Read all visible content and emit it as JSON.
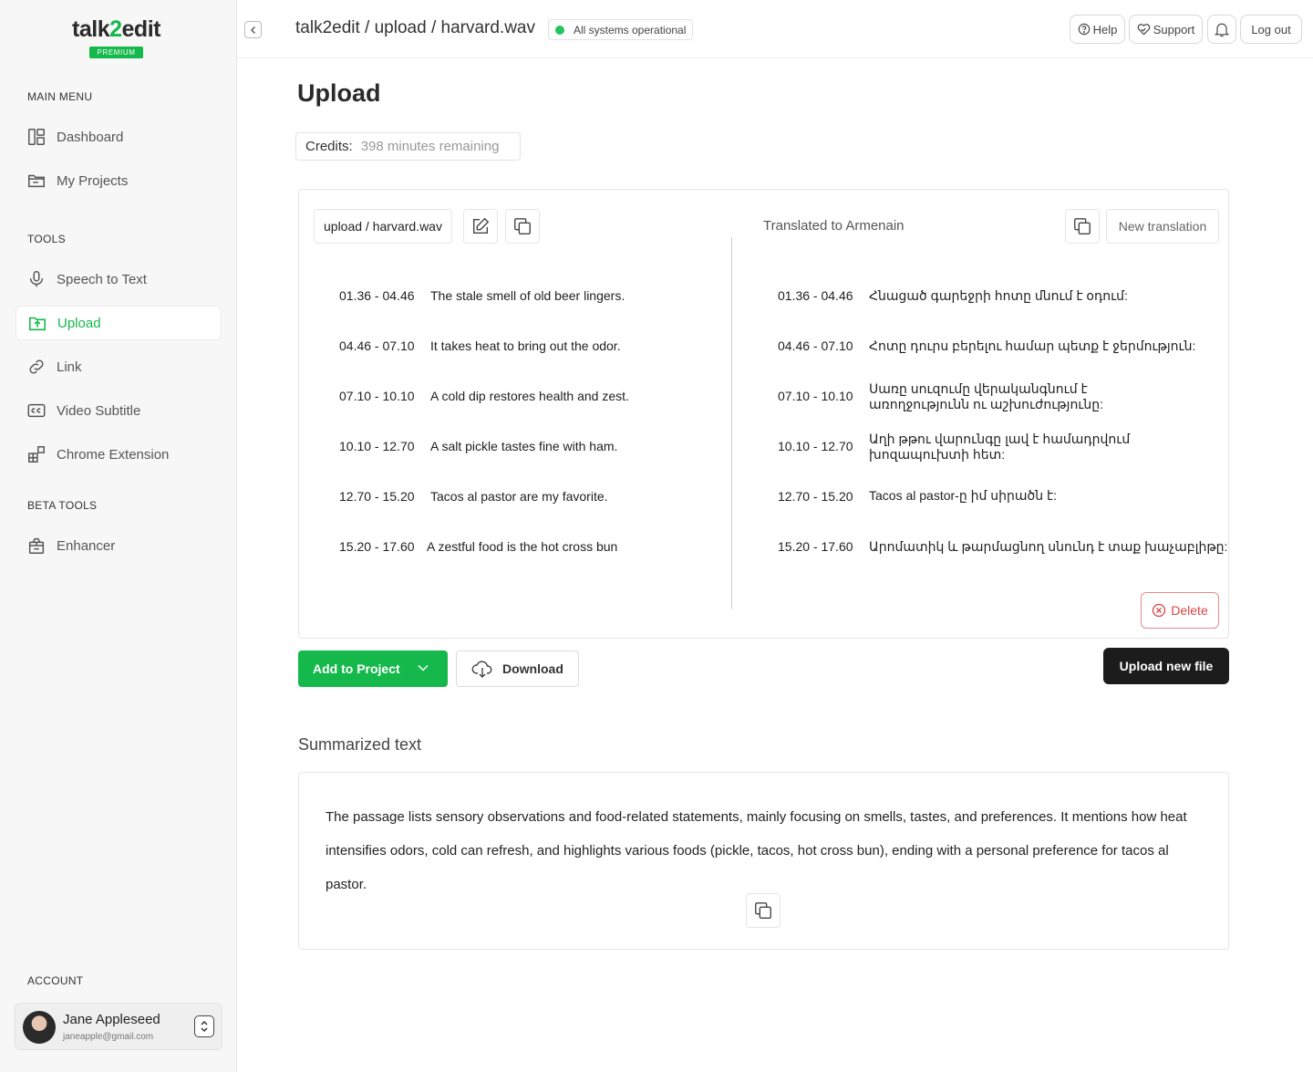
{
  "sidebar": {
    "logo": {
      "part1": "talk",
      "part2": "2",
      "part3": "edit",
      "badge": "PREMIUM"
    },
    "main_menu_label": "MAIN MENU",
    "main_menu": [
      {
        "label": "Dashboard",
        "icon": "dashboard-icon"
      },
      {
        "label": "My Projects",
        "icon": "folder-icon"
      }
    ],
    "tools_label": "TOOLS",
    "tools": [
      {
        "label": "Speech to Text",
        "icon": "microphone-icon"
      },
      {
        "label": "Upload",
        "icon": "folder-upload-icon",
        "active": true
      },
      {
        "label": "Link",
        "icon": "link-icon"
      },
      {
        "label": "Video Subtitle",
        "icon": "cc-icon"
      },
      {
        "label": "Chrome Extension",
        "icon": "extension-icon"
      }
    ],
    "beta_label": "BETA TOOLS",
    "beta_tools": [
      {
        "label": "Enhancer",
        "icon": "enhancer-icon"
      }
    ],
    "account_label": "ACCOUNT",
    "account": {
      "name": "Jane Appleseed",
      "email": "janeapple@gmail.com"
    }
  },
  "topbar": {
    "breadcrumb": "talk2edit / upload / harvard.wav",
    "status": "All systems operational",
    "help": "Help",
    "support": "Support",
    "logout": "Log out"
  },
  "main": {
    "title": "Upload",
    "credits_label": "Credits:",
    "credits_value": "398 minutes remaining",
    "file_name": "upload / harvard.wav",
    "translated_label": "Translated to Armenain",
    "new_translation": "New translation",
    "original_rows": [
      {
        "time": "01.36 - 04.46",
        "text": "The stale smell of old beer lingers."
      },
      {
        "time": "04.46 - 07.10",
        "text": "It takes heat to bring out the odor."
      },
      {
        "time": "07.10 -  10.10",
        "text": "A cold dip restores health and zest."
      },
      {
        "time": "10.10 -  12.70",
        "text": "A salt pickle tastes fine with ham."
      },
      {
        "time": "12.70 -  15.20",
        "text": "Tacos al pastor are my favorite."
      },
      {
        "time": "15.20 - 17.60",
        "text": "A zestful food is the hot cross bun"
      }
    ],
    "translated_rows": [
      {
        "time": "01.36 - 04.46",
        "text": "Հնացած գարեջրի հոտը մնում է օդում:"
      },
      {
        "time": "04.46 - 07.10",
        "text": "Հոտը դուրս բերելու համար պետք է ջերմություն:"
      },
      {
        "time": "07.10 -  10.10",
        "text": "Սառը սուզումը վերականգնում է առողջությունն ու աշխուժությունը:"
      },
      {
        "time": "10.10 -  12.70",
        "text": "Աղի թթու վարունգը լավ է համադրվում խոզապուխտի հետ:"
      },
      {
        "time": "12.70 -  15.20",
        "text": "Tacos al pastor-ը իմ սիրածն է:"
      },
      {
        "time": "15.20 - 17.60",
        "text": "Արոմատիկ և թարմացնող սնունդ է տաք խաչաբլիթը:"
      }
    ],
    "delete": "Delete",
    "add_to_project": "Add to Project",
    "download": "Download",
    "upload_new": "Upload new file",
    "summary_title": "Summarized text",
    "summary": "The passage lists sensory observations and food-related statements, mainly focusing on smells, tastes, and preferences. It mentions how heat  intensifies odors, cold can refresh, and highlights various foods (pickle, tacos, hot cross bun), ending with a personal preference for tacos al pastor."
  },
  "colors": {
    "accent": "#14b84b",
    "danger": "#d94444",
    "dark": "#1c1c1c",
    "status_ok": "#22c55e"
  }
}
